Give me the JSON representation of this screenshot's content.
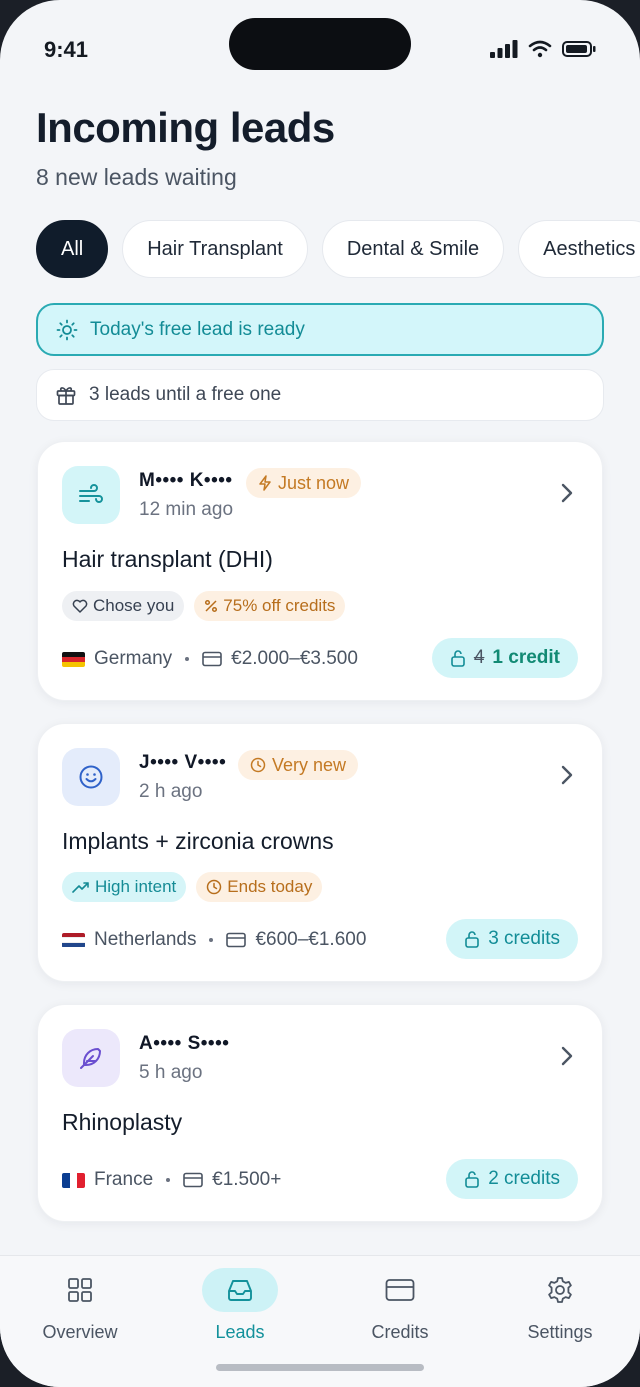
{
  "status_bar": {
    "time": "9:41"
  },
  "header": {
    "title": "Incoming leads",
    "subtitle": "8 new leads waiting"
  },
  "filters": [
    {
      "label": "All",
      "active": true
    },
    {
      "label": "Hair Transplant",
      "active": false
    },
    {
      "label": "Dental & Smile",
      "active": false
    },
    {
      "label": "Aesthetics",
      "active": false
    }
  ],
  "banners": {
    "free_lead": "Today's free lead is ready",
    "until_free": "3 leads until a free one"
  },
  "leads": [
    {
      "name": "M•••• K••••",
      "ago": "12 min ago",
      "badge": "Just now",
      "service": "Hair transplant (DHI)",
      "tags": [
        "Chose you",
        "75% off credits"
      ],
      "country": "Germany",
      "budget": "€2.000–€3.500",
      "old_cost": "4",
      "cost": "1 credit"
    },
    {
      "name": "J•••• V••••",
      "ago": "2 h ago",
      "badge": "Very new",
      "service": "Implants + zirconia crowns",
      "tags": [
        "High intent",
        "Ends today"
      ],
      "country": "Netherlands",
      "budget": "€600–€1.600",
      "cost": "3 credits"
    },
    {
      "name": "A•••• S••••",
      "ago": "5 h ago",
      "service": "Rhinoplasty",
      "country": "France",
      "budget": "€1.500+",
      "cost": "2 credits"
    }
  ],
  "tabs": [
    {
      "label": "Overview",
      "icon": "grid-icon"
    },
    {
      "label": "Leads",
      "icon": "inbox-icon",
      "active": true
    },
    {
      "label": "Credits",
      "icon": "card-icon"
    },
    {
      "label": "Settings",
      "icon": "gear-icon"
    }
  ],
  "colors": {
    "accent": "#13919b",
    "dark": "#101c2b",
    "warning": "#c47a24"
  }
}
